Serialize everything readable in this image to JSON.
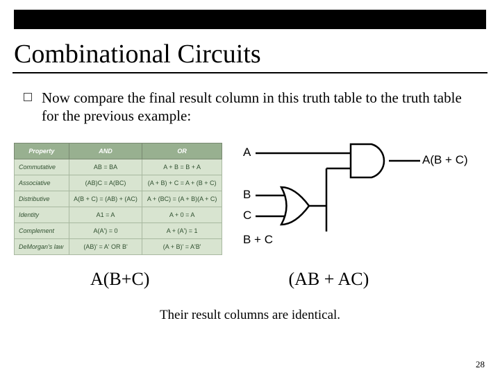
{
  "title": "Combinational Circuits",
  "bullet": "Now compare the final result column in this truth table to the truth table for the previous example:",
  "table": {
    "headers": [
      "Property",
      "AND",
      "OR"
    ],
    "rows": [
      [
        "Commutative",
        "AB = BA",
        "A + B = B + A"
      ],
      [
        "Associative",
        "(AB)C = A(BC)",
        "(A + B) + C = A + (B + C)"
      ],
      [
        "Distributive",
        "A(B + C) = (AB) + (AC)",
        "A + (BC) = (A + B)(A + C)"
      ],
      [
        "Identity",
        "A1 = A",
        "A + 0 = A"
      ],
      [
        "Complement",
        "A(A') = 0",
        "A + (A') = 1"
      ],
      [
        "DeMorgan's law",
        "(AB)' = A' OR B'",
        "(A + B)' = A'B'"
      ]
    ]
  },
  "circuit": {
    "inA": "A",
    "inB": "B",
    "inC": "C",
    "orOut": "B + C",
    "andOut": "A(B + C)"
  },
  "formulas": {
    "left": "A(B+C)",
    "right": "(AB + AC)"
  },
  "footer": "Their result columns are identical.",
  "page_number": "28"
}
